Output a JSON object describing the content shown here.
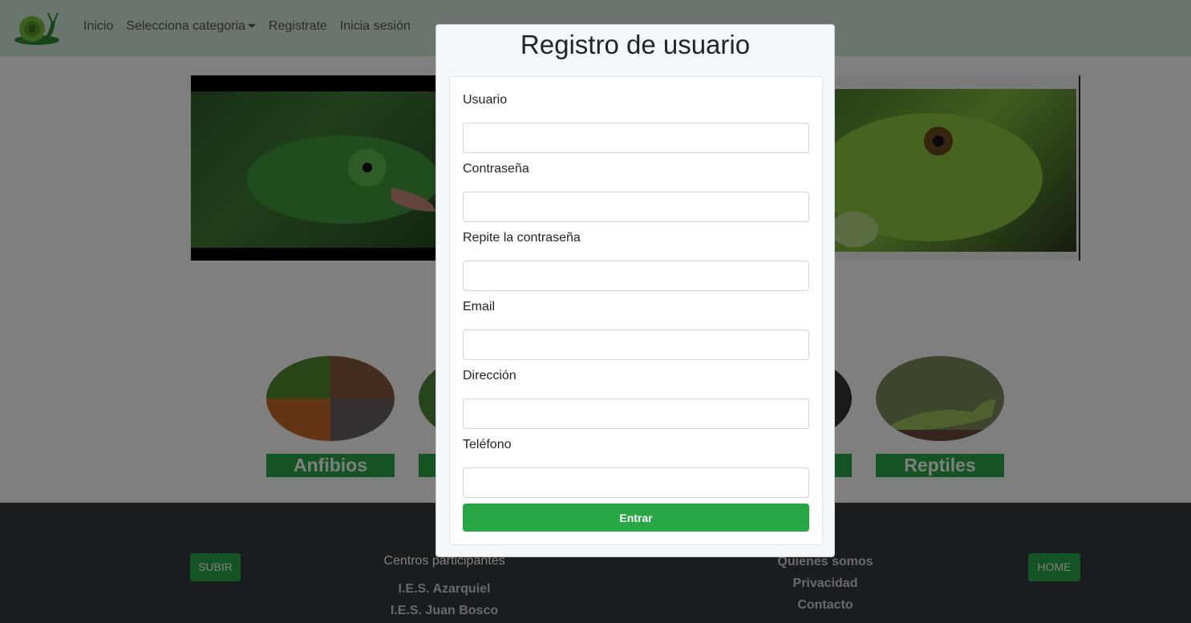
{
  "nav": {
    "links": [
      "Inicio",
      "Selecciona categoria",
      "Registrate",
      "Inicia sesión"
    ]
  },
  "categories": [
    {
      "label": "Anfibios"
    },
    {
      "label": ""
    },
    {
      "label": ""
    },
    {
      "label": "Reptiles"
    }
  ],
  "footer": {
    "up_button": "SUBIR",
    "home_button": "HOME",
    "centers_heading": "Centros participantes",
    "centers": [
      "I.E.S. Azarquiel",
      "I.E.S. Juan Bosco"
    ],
    "links": [
      "Quienes somos",
      "Privacidad",
      "Contacto"
    ]
  },
  "modal": {
    "title": "Registro de usuario",
    "fields": [
      {
        "label": "Usuario",
        "value": "",
        "type": "text"
      },
      {
        "label": "Contraseña",
        "value": "",
        "type": "password"
      },
      {
        "label": "Repite la contraseña",
        "value": "",
        "type": "password"
      },
      {
        "label": "Email",
        "value": "",
        "type": "email"
      },
      {
        "label": "Dirección",
        "value": "",
        "type": "text"
      },
      {
        "label": "Teléfono",
        "value": "",
        "type": "tel"
      }
    ],
    "submit_label": "Entrar"
  },
  "colors": {
    "accent_green": "#28a745",
    "navbar_bg": "#d4edda",
    "footer_bg": "#343a40"
  }
}
